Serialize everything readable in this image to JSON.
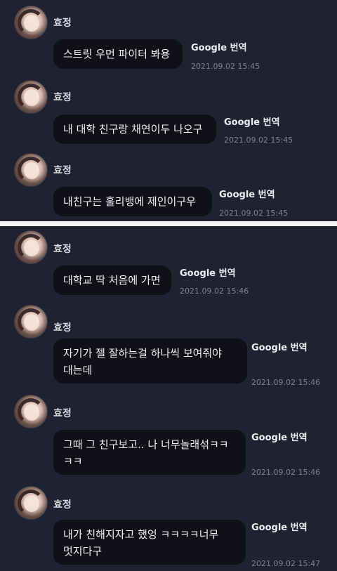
{
  "messages": [
    {
      "sender": "효정",
      "text": "스트릿 우먼 파이터 봐용",
      "translate_label": "Google 번역",
      "timestamp": "2021.09.02 15:45"
    },
    {
      "sender": "효정",
      "text": "내 대학 친구랑 채연이두 나오구",
      "translate_label": "Google 번역",
      "timestamp": "2021.09.02 15:45"
    },
    {
      "sender": "효정",
      "text": "내친구는 훌리뱅에 제인이구우",
      "translate_label": "Google 번역",
      "timestamp": "2021.09.02 15:45"
    },
    {
      "sender": "효정",
      "text": "대학교 딱 처음에 가면",
      "translate_label": "Google 번역",
      "timestamp": "2021.09.02 15:46"
    },
    {
      "sender": "효정",
      "text": [
        "자기가 젤 잘하는걸 하나씩 보여줘야",
        "대는데"
      ],
      "translate_label": "Google 번역",
      "timestamp": "2021.09.02 15:46"
    },
    {
      "sender": "효정",
      "text": [
        "그때 그 친구보고.. 나 너무놀래섞ㅋㅋ",
        "ㅋㅋ"
      ],
      "translate_label": "Google 번역",
      "timestamp": "2021.09.02 15:46"
    },
    {
      "sender": "효정",
      "text": [
        "내가 친해지자고 했엉 ㅋㅋㅋㅋ너무",
        "멋지다구"
      ],
      "translate_label": "Google 번역",
      "timestamp": "2021.09.02 15:47"
    }
  ]
}
